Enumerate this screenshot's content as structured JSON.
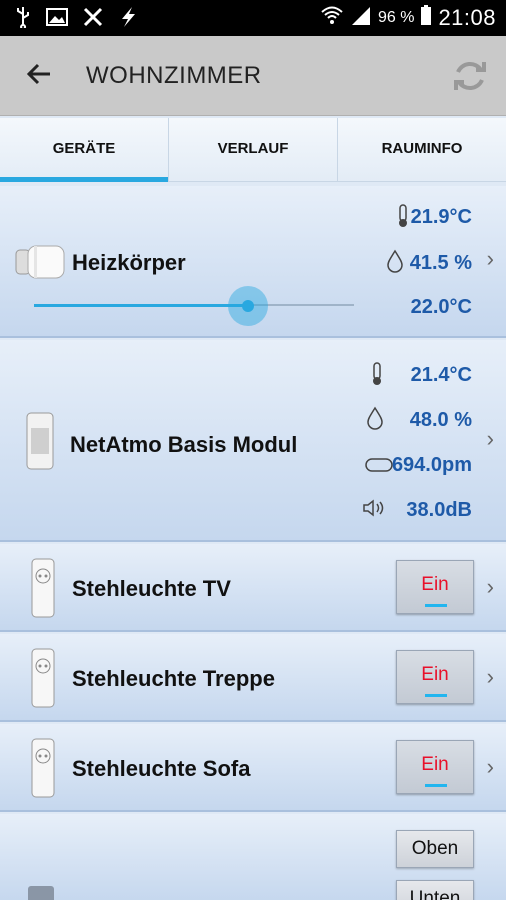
{
  "statusbar": {
    "battery": "96 %",
    "time": "21:08"
  },
  "appbar": {
    "title": "WOHNZIMMER"
  },
  "tabs": [
    {
      "label": "GERÄTE",
      "active": true
    },
    {
      "label": "VERLAUF",
      "active": false
    },
    {
      "label": "RAUMINFO",
      "active": false
    }
  ],
  "devices": {
    "heater": {
      "name": "Heizkörper",
      "temp": "21.9°C",
      "humidity": "41.5 %",
      "setpoint": "22.0°C",
      "slider_level": 0.67
    },
    "netatmo": {
      "name": "NetAtmo Basis Modul",
      "temp": "21.4°C",
      "humidity": "48.0 %",
      "co2": "694.0pm",
      "noise": "38.0dB"
    },
    "lamp_tv": {
      "name": "Stehleuchte TV",
      "button": "Ein"
    },
    "lamp_stairs": {
      "name": "Stehleuchte Treppe",
      "button": "Ein"
    },
    "lamp_sofa": {
      "name": "Stehleuchte Sofa",
      "button": "Ein"
    },
    "blind": {
      "button_up": "Oben",
      "button_down": "Unten"
    }
  },
  "colors": {
    "accent": "#29a8e0",
    "value": "#1e5aa8",
    "ein": "#e8102a"
  }
}
